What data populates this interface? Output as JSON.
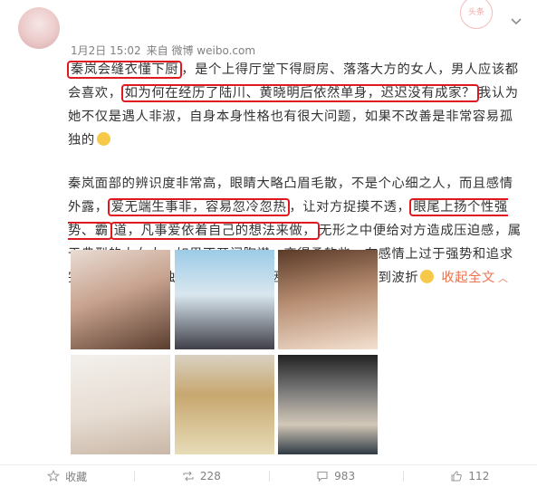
{
  "post": {
    "meta": {
      "time": "1月2日 15:02",
      "source": "来自 微博 weibo.com"
    },
    "paragraph1": {
      "hl1": "秦岚会缝衣懂下厨",
      "t1": "，是个上得厅堂下得厨房、落落大方的女人，男人应该都会喜欢，",
      "hl2": "如为何在经历了陆川、黄晓明后依然单身，迟迟没有成家？",
      "t2": "我认为她不仅是遇人非淑，自身本身性格也有很大问题，如果不改善是非常容易孤独的"
    },
    "paragraph2": {
      "t1": "秦岚面部的辨识度非常高，眼睛大略凸眉毛散，不是个心细之人，而且感情外露，",
      "hl1": "爱无端生事非，容易忽冷忽热",
      "t2": "，让对方捉摸不透，",
      "hl2a": "眼尾上扬个性强势、霸",
      "hl2b": "道，凡事爱依着自己的想法来做，",
      "t3": "无形之中便给对方造成压迫感，属于典型的大女人，如果不开阔胸襟、变得柔软些，在感情上过于强势和追求完美，就容易孤独终老，事业更为因为情感而再次收到波折",
      "expand": "收起全文"
    },
    "stamp": "头条"
  },
  "actions": {
    "favorite": "收藏",
    "repost": "228",
    "comment": "983",
    "like": "112"
  },
  "colors": {
    "highlight_border": "#e0181f",
    "expand_link": "#eb7350"
  }
}
